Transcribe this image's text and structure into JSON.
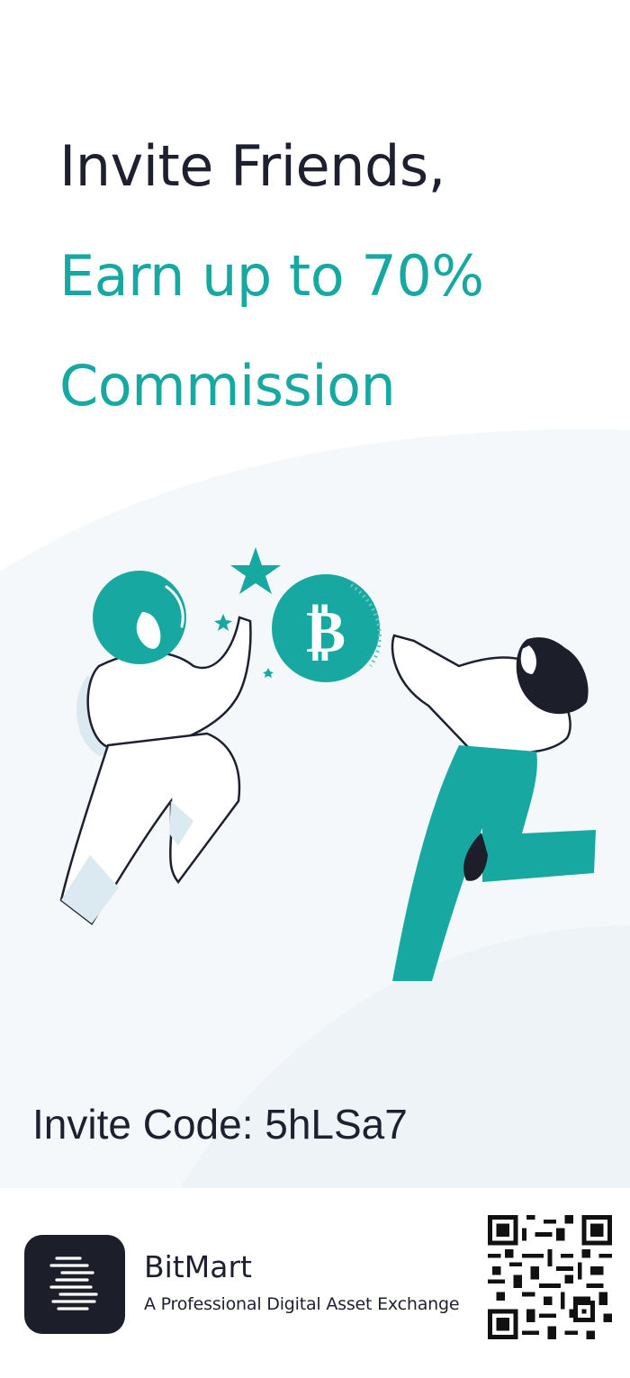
{
  "headline": {
    "line1": "Invite Friends,",
    "line2": "Earn up to 70%",
    "line3": "Commission"
  },
  "invite": {
    "label": "Invite Code:",
    "code": "5hLSa7",
    "text": "Invite Code: 5hLSa7"
  },
  "brand": {
    "name": "BitMart",
    "tagline": "A Professional Digital Asset Exchange"
  },
  "colors": {
    "accent": "#17a9a1",
    "text_dark": "#1e2030",
    "background_soft": "#f4f8fa",
    "logo_bg": "#1c1e2a"
  },
  "icons": {
    "coin": "bitcoin-icon",
    "logo": "bitmart-logo-icon",
    "qr": "qr-code"
  }
}
